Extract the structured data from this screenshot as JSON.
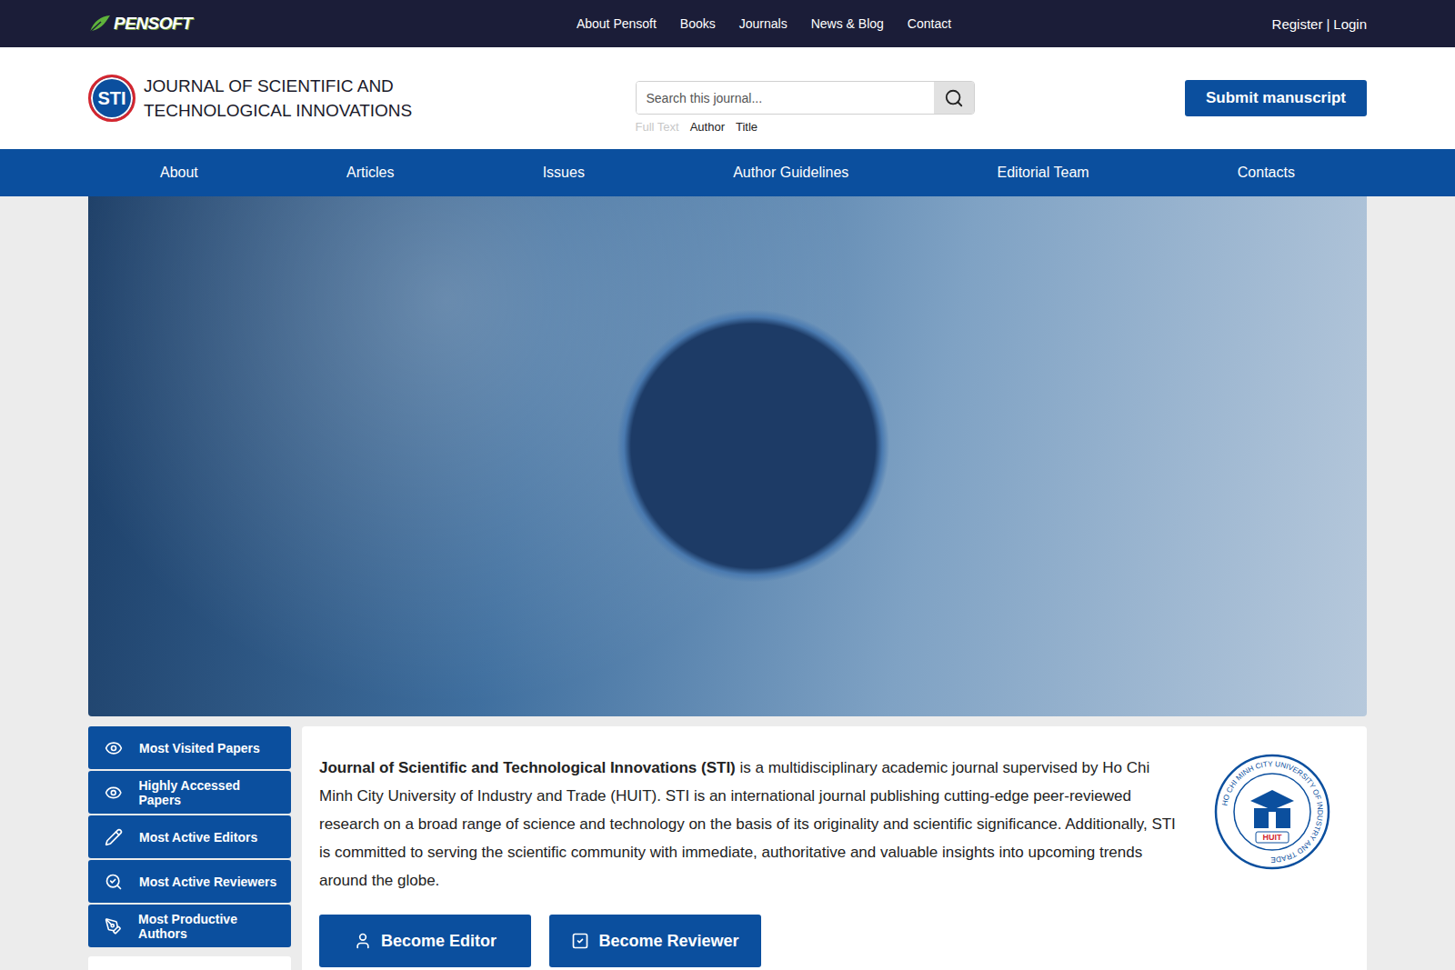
{
  "top_bar": {
    "logo": "PENSOFT",
    "nav": [
      "About Pensoft",
      "Books",
      "Journals",
      "News & Blog",
      "Contact"
    ],
    "auth": {
      "register": "Register",
      "separator": "|",
      "login": "Login"
    }
  },
  "header": {
    "logo": "STI",
    "title_lines": [
      "JOURNAL OF SCIENTIFIC AND",
      "TECHNOLOGICAL INNOVATIONS"
    ],
    "search": {
      "placeholder": "Search this journal...",
      "modes": [
        {
          "label": "Full Text",
          "disabled": true
        },
        {
          "label": "Author",
          "disabled": false
        },
        {
          "label": "Title",
          "disabled": false
        }
      ]
    },
    "submit_button": "Submit manuscript"
  },
  "main_nav": [
    "About",
    "Articles",
    "Issues",
    "Author Guidelines",
    "Editorial Team",
    "Contacts"
  ],
  "sidebar": {
    "items": [
      "Most Visited Papers",
      "Highly Accessed Papers",
      "Most Active Editors",
      "Most Active Reviewers",
      "Most Productive Authors"
    ]
  },
  "intro": {
    "journal_name": "Journal of Scientific and Technological Innovations (STI)",
    "text": " is a multidisciplinary academic journal supervised by Ho Chi Minh City University of Industry and Trade (HUIT). STI is an international journal publishing cutting-edge peer-reviewed research on a broad range of science and technology on the basis of its originality and scientific significance. Additionally, STI is committed to serving the scientific community with immediate, authoritative and valuable insights into upcoming trends around the globe.",
    "institution_logo": {
      "ring_text": "HO CHI MINH CITY UNIVERSITY OF INDUSTRY AND TRADE",
      "badge": "HUIT"
    },
    "buttons": [
      "Become Editor",
      "Become Reviewer"
    ]
  }
}
